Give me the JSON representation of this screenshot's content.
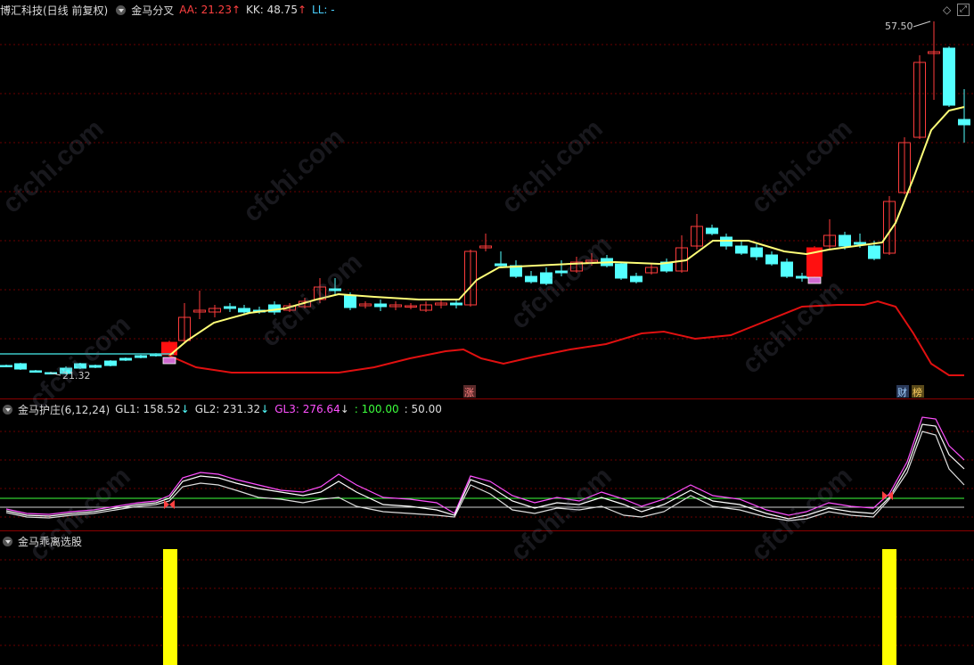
{
  "main_panel": {
    "stock_title": "博汇科技(日线 前复权)",
    "indicator_name": "金马分叉",
    "aa_label": "AA: 21.23",
    "kk_label": "KK: 48.75",
    "ll_label": "LL: -",
    "high_price_label": "57.50",
    "low_price_label": "21.32",
    "event_zhang": "涨",
    "event_cai": "财",
    "event_bang": "榜"
  },
  "sub_panel": {
    "indicator_name": "金马护庄(6,12,24)",
    "gl1_label": "GL1: 158.52",
    "gl2_label": "GL2: 231.32",
    "gl3_label": "GL3: 276.64",
    "level_green_label": ": 100.00",
    "level_white_label": ": 50.00"
  },
  "bottom_panel": {
    "indicator_name": "金马乖离选股"
  },
  "watermark": "cfchi.com",
  "colors": {
    "up": "#ff3c3c",
    "down": "#54ffff",
    "ma_yellow": "#ffff78",
    "red_line": "#e01010",
    "magenta": "#ff50ff",
    "green": "#3cff3c",
    "bar_yellow": "#ffff00"
  }
}
